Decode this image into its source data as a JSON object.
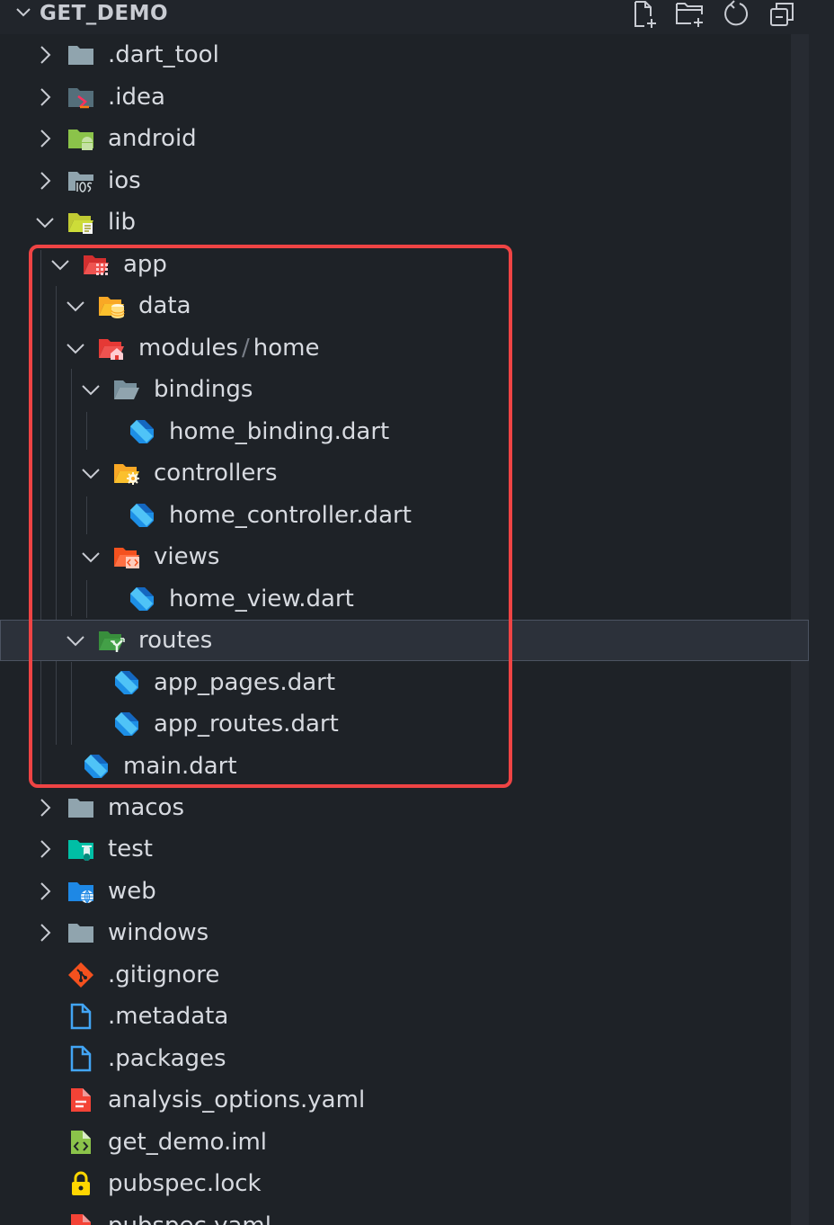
{
  "explorer": {
    "title": "GET_DEMO",
    "actions": [
      "new-file-icon",
      "new-folder-icon",
      "refresh-icon",
      "collapse-all-icon"
    ]
  },
  "tree": {
    "dart_tool": ".dart_tool",
    "idea": ".idea",
    "android": "android",
    "ios": "ios",
    "lib": "lib",
    "app": "app",
    "data": "data",
    "modules": "modules",
    "modules_sep": "/",
    "home": "home",
    "bindings": "bindings",
    "home_binding": "home_binding.dart",
    "controllers": "controllers",
    "home_controller": "home_controller.dart",
    "views": "views",
    "home_view": "home_view.dart",
    "routes": "routes",
    "app_pages": "app_pages.dart",
    "app_routes": "app_routes.dart",
    "main": "main.dart",
    "macos": "macos",
    "test": "test",
    "web": "web",
    "windows": "windows",
    "gitignore": ".gitignore",
    "metadata": ".metadata",
    "packages": ".packages",
    "analysis_options": "analysis_options.yaml",
    "get_demo_iml": "get_demo.iml",
    "pubspec_lock": "pubspec.lock",
    "pubspec_yaml": "pubspec.yaml"
  },
  "colors": {
    "highlight_border": "#ef4444",
    "dart_blue": "#1d8fe6",
    "folder_grey": "#90a4ae"
  }
}
